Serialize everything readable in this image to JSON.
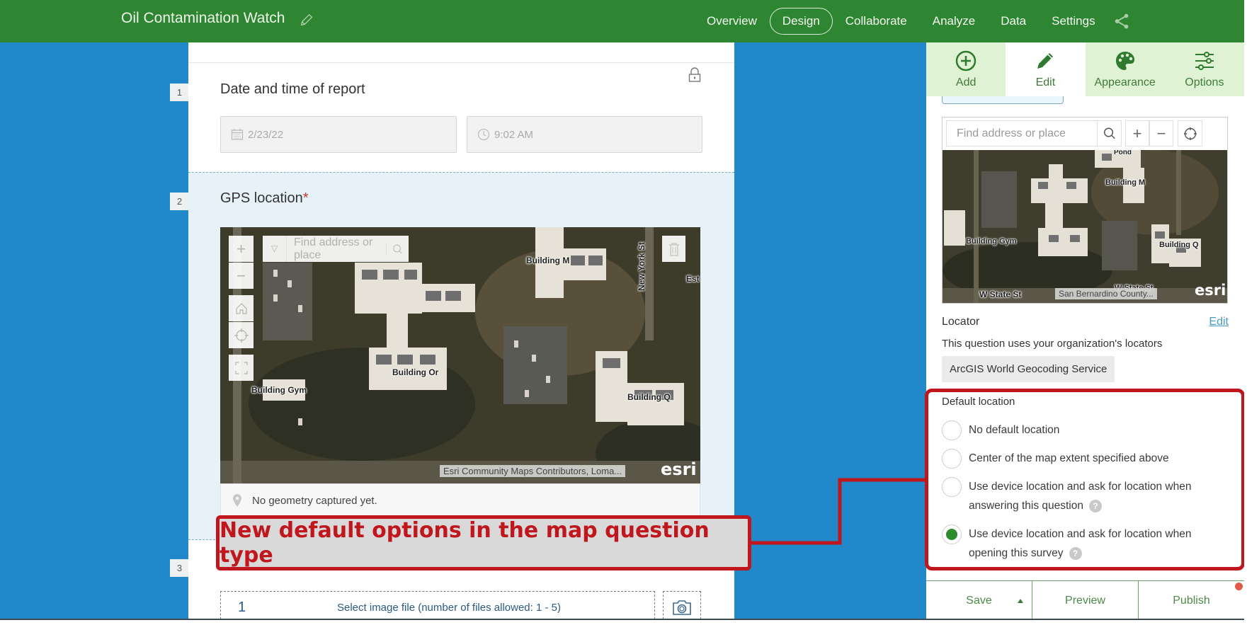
{
  "header": {
    "app_title": "Oil Contamination Watch",
    "nav": [
      {
        "label": "Overview",
        "active": false
      },
      {
        "label": "Design",
        "active": true
      },
      {
        "label": "Collaborate",
        "active": false
      },
      {
        "label": "Analyze",
        "active": false
      },
      {
        "label": "Data",
        "active": false
      },
      {
        "label": "Settings",
        "active": false
      }
    ],
    "share_icon": "share-icon",
    "edit_icon": "pencil-icon"
  },
  "form": {
    "questions": [
      {
        "number": "1",
        "title": "Date and time of report",
        "date_value": "2/23/22",
        "time_value": "9:02 AM",
        "lock_icon": "lock-icon"
      },
      {
        "number": "2",
        "title": "GPS location",
        "required_mark": "*",
        "map": {
          "search_placeholder": "Find address or place",
          "labels": [
            "Building M",
            "Building Or",
            "Building Gym",
            "Building Q",
            "New York St",
            "Est"
          ],
          "attribution": "Esri Community Maps Contributors, Loma...",
          "logo": "esri"
        },
        "geometry_status": "No geometry captured yet."
      },
      {
        "number": "3",
        "upload_count": "1",
        "upload_label": "Select image file (number of files allowed: 1 - 5)"
      }
    ]
  },
  "side_panel": {
    "tabs": [
      {
        "label": "Add",
        "icon": "plus-circle-icon",
        "active": false
      },
      {
        "label": "Edit",
        "icon": "pencil-icon",
        "active": true
      },
      {
        "label": "Appearance",
        "icon": "palette-icon",
        "active": false
      },
      {
        "label": "Options",
        "icon": "sliders-icon",
        "active": false
      }
    ],
    "map": {
      "search_placeholder": "Find address or place",
      "labels": [
        "Pond",
        "Building M",
        "Building Gym",
        "Building Q",
        "W State St",
        "W State St"
      ],
      "attribution": "San Bernardino County...",
      "logo": "esri"
    },
    "locator": {
      "heading": "Locator",
      "edit_link": "Edit",
      "description": "This question uses your organization's locators",
      "service": "ArcGIS World Geocoding Service"
    },
    "default_location": {
      "heading": "Default location",
      "options": [
        {
          "label": "No default location",
          "selected": false,
          "help": false
        },
        {
          "label": "Center of the map extent specified above",
          "selected": false,
          "help": false
        },
        {
          "label_line1": "Use device location and ask for location when",
          "label_line2": "answering this question",
          "selected": false,
          "help": true
        },
        {
          "label_line1": "Use device location and ask for location when",
          "label_line2": "opening this survey",
          "selected": true,
          "help": true
        }
      ]
    },
    "actions": {
      "save": "Save",
      "preview": "Preview",
      "publish": "Publish"
    }
  },
  "callout": {
    "text": "New default options in the map question type",
    "color": "#c0161d"
  },
  "colors": {
    "header_green": "#2f8632",
    "background_blue": "#2189c9",
    "tab_green": "#dff3d4",
    "radio_selected": "#2e8b2e"
  }
}
